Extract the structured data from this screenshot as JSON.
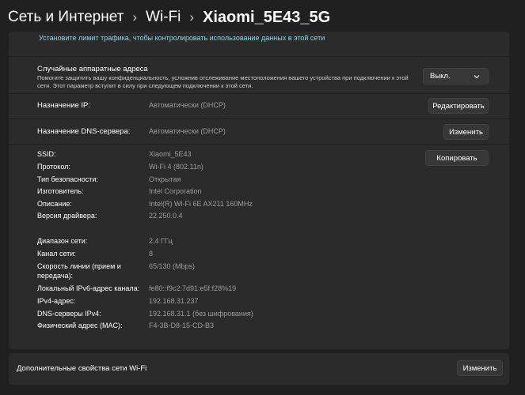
{
  "breadcrumb": {
    "items": [
      "Сеть и Интернет",
      "Wi-Fi",
      "Xiaomi_5E43_5G"
    ],
    "separator": "›"
  },
  "traffic_limit_link": "Установите лимит трафика, чтобы контролировать использование данных в этой сети",
  "random_mac": {
    "title": "Случайные аппаратные адреса",
    "description": "Помогите защитить вашу конфиденциальность, усложнив отслеживание местоположения вашего устройства при подключении к этой сети. Этот параметр вступит в силу при следующем подключении к этой сети.",
    "selected": "Выкл."
  },
  "ip_assignment": {
    "label": "Назначение IP:",
    "value": "Автоматически (DHCP)",
    "button": "Редактировать"
  },
  "dns_assignment": {
    "label": "Назначение DNS-сервера:",
    "value": "Автоматически (DHCP)",
    "button": "Изменить"
  },
  "copy_button": "Копировать",
  "properties_group1": [
    {
      "label": "SSID:",
      "value": "Xiaomi_5E43"
    },
    {
      "label": "Протокол:",
      "value": "Wi-Fi 4 (802.11n)"
    },
    {
      "label": "Тип безопасности:",
      "value": "Открытая"
    },
    {
      "label": "Изготовитель:",
      "value": "Intel Corporation"
    },
    {
      "label": "Описание:",
      "value": "Intel(R) Wi-Fi 6E AX211 160MHz"
    },
    {
      "label": "Версия драйвера:",
      "value": "22.250.0.4"
    }
  ],
  "properties_group2": [
    {
      "label": "Диапазон сети:",
      "value": "2,4 ГГц"
    },
    {
      "label": "Канал сети:",
      "value": "8"
    },
    {
      "label": "Скорость линии (прием и",
      "label2": "передача):",
      "value": "65/130 (Mbps)"
    },
    {
      "label": "Локальный IPv6-адрес канала:",
      "value": "fe80::f9c2:7d91:e5f:f28%19"
    },
    {
      "label": "IPv4-адрес:",
      "value": "192.168.31.237"
    },
    {
      "label": "DNS-серверы IPv4:",
      "value": "192.168.31.1 (без шифрования)"
    },
    {
      "label": "Физический адрес (MAC):",
      "value": "F4-3B-D8-15-CD-B3"
    }
  ],
  "footer": {
    "label": "Дополнительные свойства сети Wi-Fi",
    "button": "Изменить"
  },
  "icons": {
    "chevron": "chevron-down-icon"
  }
}
